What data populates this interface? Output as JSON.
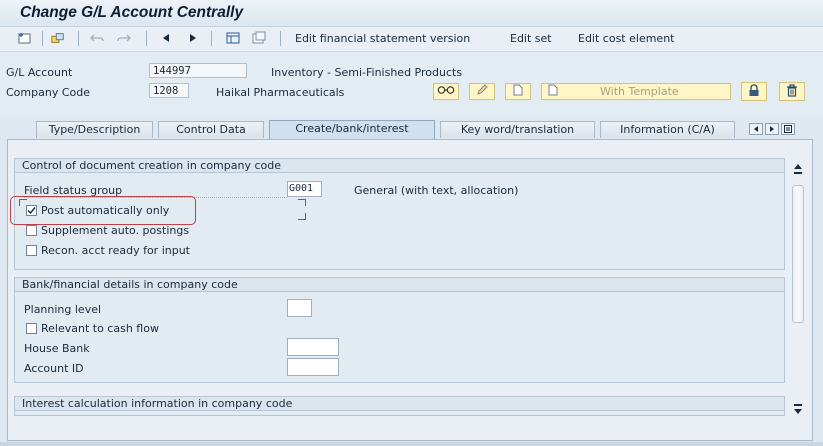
{
  "window": {
    "title": "Change G/L Account Centrally"
  },
  "toolbar": {
    "edit_fs_version": "Edit financial statement version",
    "edit_set": "Edit set",
    "edit_cost_element": "Edit cost element"
  },
  "header": {
    "gl_account_label": "G/L Account",
    "gl_account_value": "144997",
    "gl_account_desc": "Inventory - Semi-Finished Products",
    "company_code_label": "Company Code",
    "company_code_value": "1208",
    "company_code_desc": "Haikal Pharmaceuticals",
    "with_template_label": "With Template"
  },
  "tabs": [
    {
      "label": "Type/Description",
      "active": false
    },
    {
      "label": "Control Data",
      "active": false
    },
    {
      "label": "Create/bank/interest",
      "active": true
    },
    {
      "label": "Key word/translation",
      "active": false
    },
    {
      "label": "Information (C/A)",
      "active": false
    }
  ],
  "doc_creation": {
    "header": "Control of document creation in company code",
    "field_status_group_label": "Field status group",
    "field_status_group_value": "G001",
    "field_status_group_desc": "General (with text, allocation)",
    "post_auto_label": "Post automatically only",
    "post_auto_checked": true,
    "supplement_label": "Supplement auto. postings",
    "supplement_checked": false,
    "recon_label": "Recon. acct ready for input",
    "recon_checked": false
  },
  "bank": {
    "header": "Bank/financial details in company code",
    "planning_level_label": "Planning level",
    "planning_level_value": "",
    "relevant_cash_label": "Relevant to cash flow",
    "relevant_cash_checked": false,
    "house_bank_label": "House Bank",
    "house_bank_value": "",
    "account_id_label": "Account ID",
    "account_id_value": ""
  },
  "interest": {
    "header": "Interest calculation information in company code"
  },
  "colors": {
    "highlight": "#c0404a",
    "field_focus": "#d83030"
  }
}
